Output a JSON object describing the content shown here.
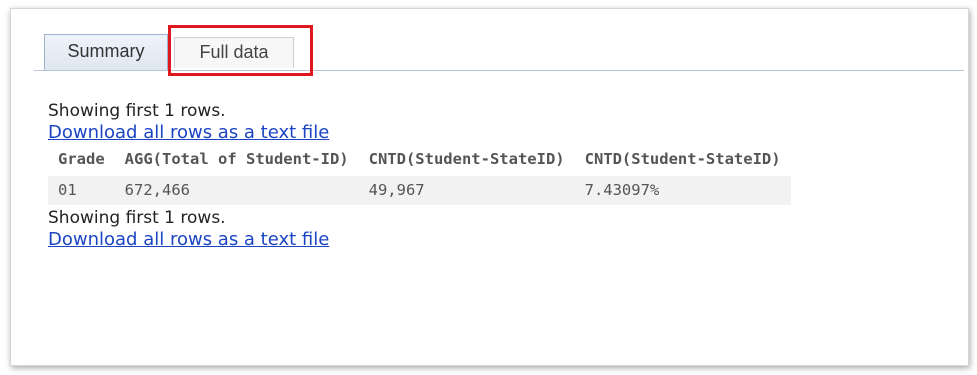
{
  "tabs": {
    "summary_label": "Summary",
    "full_data_label": "Full data"
  },
  "results": {
    "showing_text": "Showing first 1 rows.",
    "download_link": "Download all rows as a text file",
    "columns": [
      "Grade",
      "AGG(Total of Student-ID)",
      "CNTD(Student-StateID)",
      "CNTD(Student-StateID)"
    ],
    "rows": [
      [
        "01",
        "672,466",
        "49,967",
        "7.43097%"
      ]
    ]
  },
  "colors": {
    "highlight": "#e0171e",
    "link": "#1a44c4",
    "row_background": "#f2f2f2"
  }
}
